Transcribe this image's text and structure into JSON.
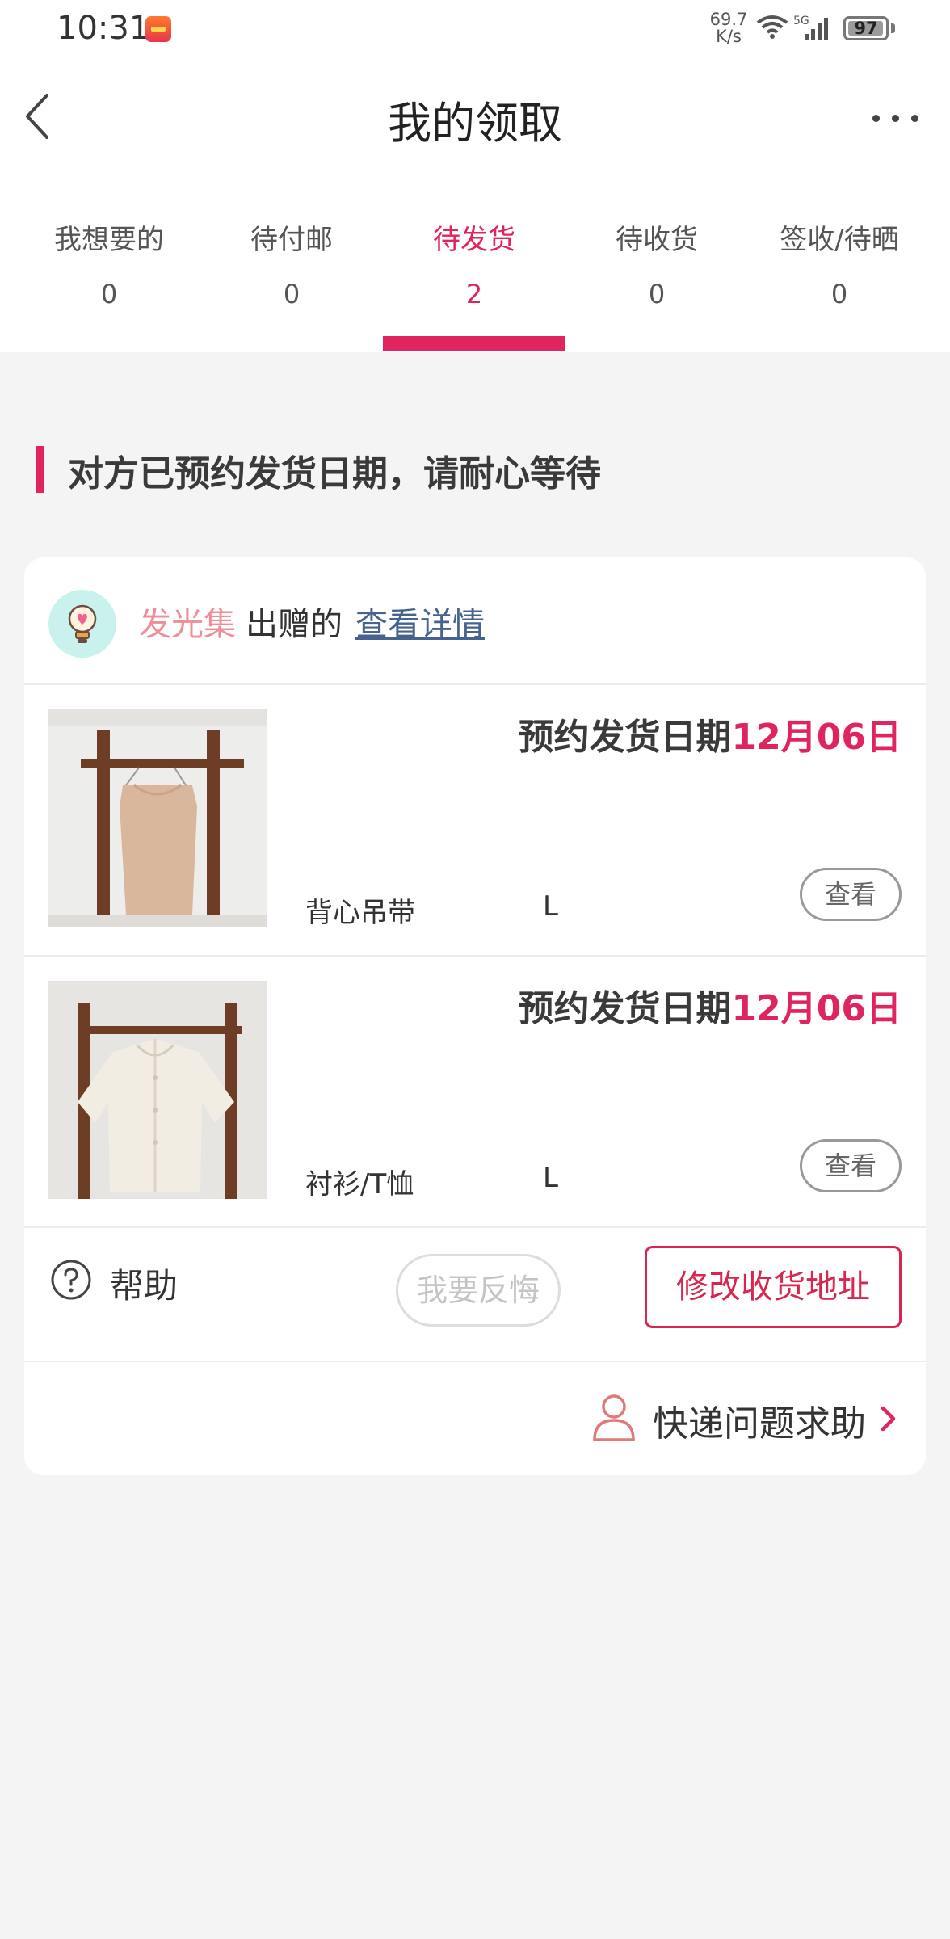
{
  "status_bar": {
    "time": "10:31",
    "net_speed_value": "69.7",
    "net_speed_unit": "K/s",
    "network_type": "5G",
    "battery": "97",
    "battery_level": 0.97
  },
  "header": {
    "title": "我的领取"
  },
  "tabs": [
    {
      "label": "我想要的",
      "count": "0"
    },
    {
      "label": "待付邮",
      "count": "0"
    },
    {
      "label": "待发货",
      "count": "2"
    },
    {
      "label": "待收货",
      "count": "0"
    },
    {
      "label": "签收/待晒",
      "count": "0"
    }
  ],
  "active_tab": 2,
  "notice": "对方已预约发货日期，请耐心等待",
  "card": {
    "giver_name": "发光集",
    "giver_suffix": "出赠的",
    "details_link": "查看详情",
    "items": [
      {
        "date_label": "预约发货日期",
        "date_value": "12月06日",
        "name": "背心吊带",
        "size": "L",
        "view_label": "查看"
      },
      {
        "date_label": "预约发货日期",
        "date_value": "12月06日",
        "name": "衬衫/T恤",
        "size": "L",
        "view_label": "查看"
      }
    ],
    "help_label": "帮助",
    "regret_label": "我要反悔",
    "address_label": "修改收货地址",
    "express_help_label": "快递问题求助"
  },
  "colors": {
    "accent": "#e0245e",
    "giver_name": "#ee8f98",
    "link": "#46628f",
    "background": "#f4f4f4"
  }
}
